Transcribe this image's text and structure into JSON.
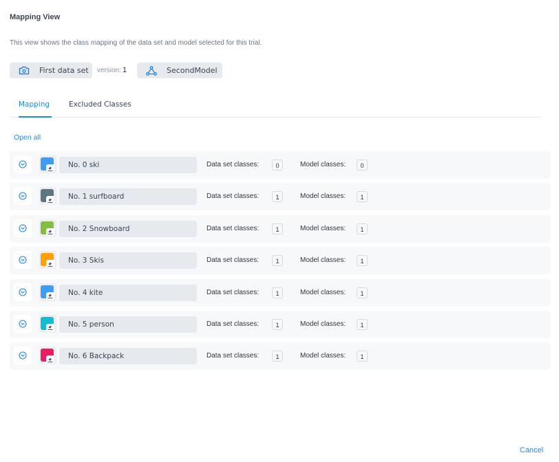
{
  "header": {
    "title": "Mapping View",
    "description": "This view shows the class mapping of the data set and model selected for this trial."
  },
  "dataset_chip": {
    "icon": "camera-icon",
    "label": "First data set"
  },
  "version": {
    "label": "version:",
    "value": "1"
  },
  "model_chip": {
    "icon": "model-network-icon",
    "label": "SecondModel"
  },
  "tabs": [
    {
      "label": "Mapping",
      "active": true
    },
    {
      "label": "Excluded Classes",
      "active": false
    }
  ],
  "open_all_label": "Open all",
  "columns": {
    "dataset_classes_label": "Data set classes:",
    "model_classes_label": "Model classes:"
  },
  "classes": [
    {
      "name": "No. 0 ski",
      "color": "#3d9cf5",
      "dataset_classes": "0",
      "model_classes": "0"
    },
    {
      "name": "No. 1 surfboard",
      "color": "#5b7582",
      "dataset_classes": "1",
      "model_classes": "1"
    },
    {
      "name": "No. 2 Snowboard",
      "color": "#84bd43",
      "dataset_classes": "1",
      "model_classes": "1"
    },
    {
      "name": "No. 3 Skis",
      "color": "#ff9e0b",
      "dataset_classes": "1",
      "model_classes": "1"
    },
    {
      "name": "No. 4 kite",
      "color": "#3d9cf5",
      "dataset_classes": "1",
      "model_classes": "1"
    },
    {
      "name": "No. 5 person",
      "color": "#12bcd1",
      "dataset_classes": "1",
      "model_classes": "1"
    },
    {
      "name": "No. 6 Backpack",
      "color": "#e91e63",
      "dataset_classes": "1",
      "model_classes": "1"
    }
  ],
  "footer": {
    "cancel_label": "Cancel"
  },
  "colors": {
    "accent": "#1e88e5"
  }
}
